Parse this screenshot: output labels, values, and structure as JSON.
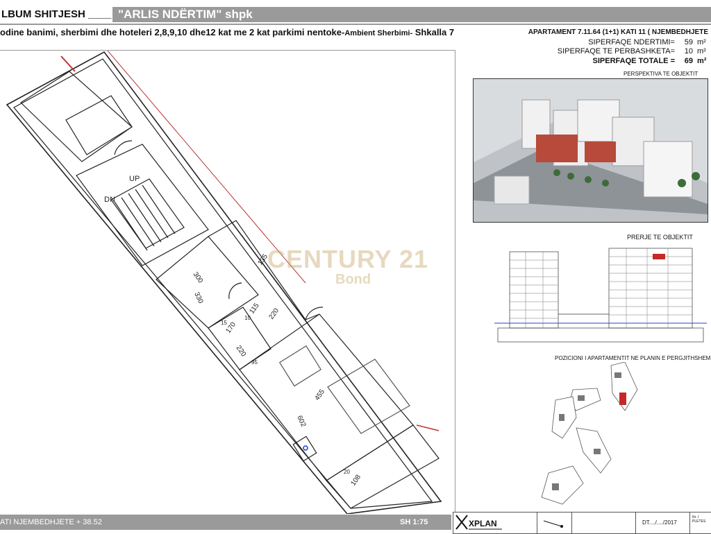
{
  "header": {
    "album": "LBUM SHITJESH ____",
    "company": "\"ARLIS NDËRTIM\" shpk"
  },
  "subtitle": {
    "main": "odine banimi, sherbimi dhe hoteleri 2,8,9,10 dhe12 kat me 2 kat parkimi nentoke-",
    "small": "Ambient Sherbimi-",
    "end": " Shkalla 7"
  },
  "apartment": {
    "title": "APARTAMENT 7.11.64 (1+1) KATI 11 ( NJEMBEDHJETE",
    "rows": [
      {
        "label": "SIPERFAQE NDERTIMI=",
        "value": "59",
        "unit": "m²"
      },
      {
        "label": "SIPERFAQE TE PERBASHKETA=",
        "value": "10",
        "unit": "m²"
      },
      {
        "label": "SIPERFAQE TOTALE =",
        "value": "69",
        "unit": "m²"
      }
    ]
  },
  "plan": {
    "labels": {
      "up": "UP",
      "dn": "DN",
      "d300": "300",
      "d330": "330",
      "d135": "135",
      "d115": "115",
      "d220a": "220",
      "d170": "170",
      "d220b": "220",
      "d455": "455",
      "d602": "602",
      "d108": "108",
      "d20": "20",
      "d10": "10",
      "d15": "15",
      "d95": "95"
    }
  },
  "watermark": {
    "brand": "CENTURY 21",
    "sub": "Bond"
  },
  "right_panel": {
    "perspective_title": "PERSPEKTIVA TE OBJEKTIT",
    "section_title": "PRERJE TE OBJEKTIT",
    "position_title": "POZICIONI I APARTAMENTIT NE PLANIN E PERGJITHSHEM"
  },
  "footer": {
    "floor": "ATI  NJEMBEDHJETE + 38.52",
    "scale": "SH 1:75",
    "logo": "XPLAN",
    "date": "DT..../..../2017",
    "sheet": "Nr. I PLETES"
  },
  "colors": {
    "header_gray": "#9a9a9a",
    "apartment_highlight": "#c62828",
    "watermark": "#c8aa6e"
  }
}
